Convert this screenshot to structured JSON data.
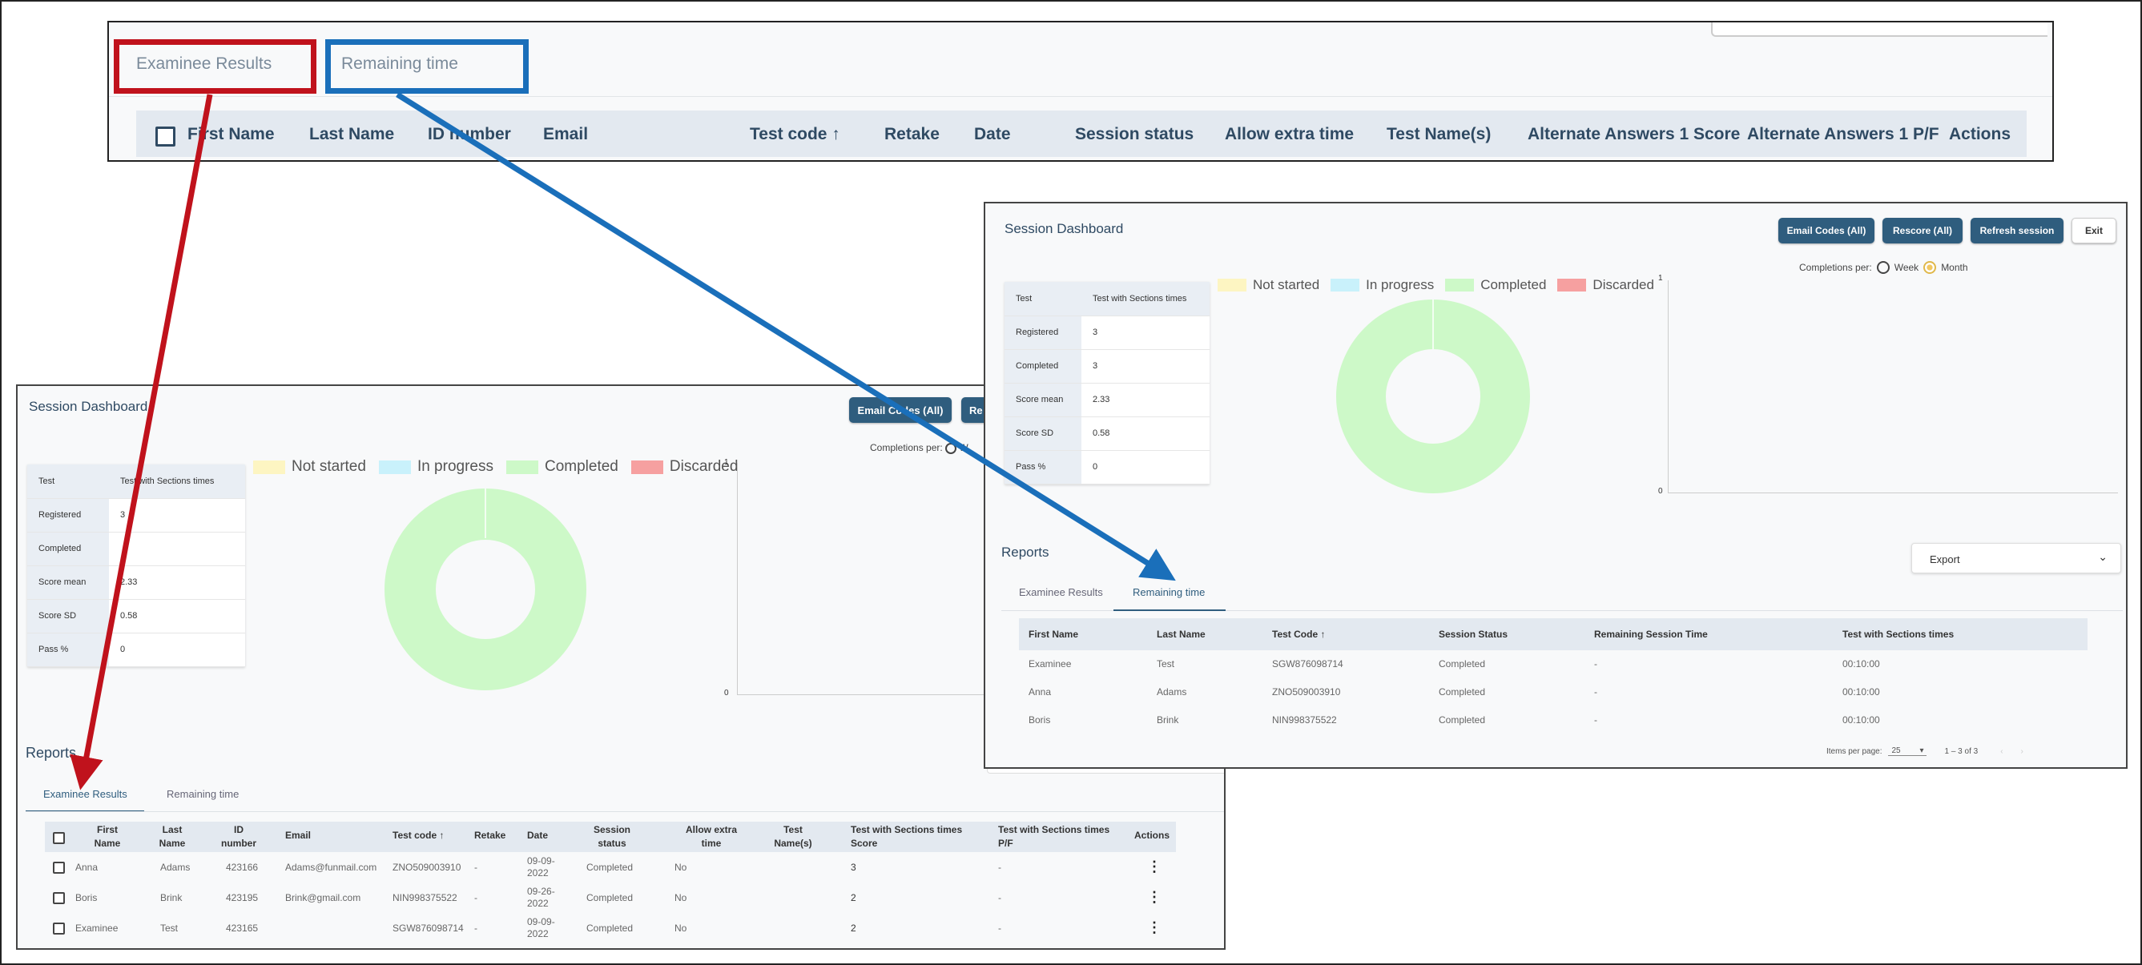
{
  "top_strip": {
    "tabs": [
      "Examinee Results",
      "Remaining time"
    ],
    "columns": [
      "First Name",
      "Last Name",
      "ID number",
      "Email",
      "Test code ↑",
      "Retake",
      "Date",
      "Session status",
      "Allow extra time",
      "Test Name(s)",
      "Alternate Answers 1 Score",
      "Alternate Answers 1 P/F",
      "Actions"
    ]
  },
  "left": {
    "title": "Session Dashboard",
    "buttons": {
      "email_codes": "Email Codes (All)",
      "rescore_partial": "Re"
    },
    "completions_label": "Completions per:",
    "week_partial": "W",
    "stats": [
      {
        "k": "Test",
        "v": "Test with Sections times"
      },
      {
        "k": "Registered",
        "v": "3"
      },
      {
        "k": "Completed",
        "v": ""
      },
      {
        "k": "Score mean",
        "v": "2.33"
      },
      {
        "k": "Score SD",
        "v": "0.58"
      },
      {
        "k": "Pass %",
        "v": "0"
      }
    ],
    "legend": [
      "Not started",
      "In progress",
      "Completed",
      "Discarded"
    ],
    "axis": {
      "y_top": "1",
      "y_bottom": "0"
    },
    "reports_title": "Reports",
    "tabs": [
      "Examinee Results",
      "Remaining time"
    ],
    "columns": [
      {
        "a": "First",
        "b": "Name"
      },
      {
        "a": "Last",
        "b": "Name"
      },
      {
        "a": "ID",
        "b": "number"
      },
      {
        "a": "Email",
        "b": ""
      },
      {
        "a": "Test code ↑",
        "b": ""
      },
      {
        "a": "Retake",
        "b": ""
      },
      {
        "a": "Date",
        "b": ""
      },
      {
        "a": "Session",
        "b": "status"
      },
      {
        "a": "Allow extra",
        "b": "time"
      },
      {
        "a": "Test",
        "b": "Name(s)"
      },
      {
        "a": "Test with Sections times",
        "b": "Score"
      },
      {
        "a": "Test with Sections times",
        "b": "P/F"
      },
      {
        "a": "Actions",
        "b": ""
      }
    ],
    "rows": [
      {
        "first": "Anna",
        "last": "Adams",
        "id": "423166",
        "email": "Adams@funmail.com",
        "code": "ZNO509003910",
        "retake": "-",
        "date1": "09-09-",
        "date2": "2022",
        "status": "Completed",
        "extra": "No",
        "score": "3",
        "pf": "-"
      },
      {
        "first": "Boris",
        "last": "Brink",
        "id": "423195",
        "email": "Brink@gmail.com",
        "code": "NIN998375522",
        "retake": "-",
        "date1": "09-26-",
        "date2": "2022",
        "status": "Completed",
        "extra": "No",
        "score": "2",
        "pf": "-"
      },
      {
        "first": "Examinee",
        "last": "Test",
        "id": "423165",
        "email": "",
        "code": "SGW876098714",
        "retake": "-",
        "date1": "09-09-",
        "date2": "2022",
        "status": "Completed",
        "extra": "No",
        "score": "2",
        "pf": "-"
      }
    ]
  },
  "right": {
    "title": "Session Dashboard",
    "buttons": {
      "email_codes": "Email Codes (All)",
      "rescore": "Rescore (All)",
      "refresh": "Refresh session",
      "exit": "Exit"
    },
    "completions_label": "Completions per:",
    "radio": {
      "week": "Week",
      "month": "Month",
      "selected": "Month"
    },
    "stats": [
      {
        "k": "Test",
        "v": "Test with Sections times"
      },
      {
        "k": "Registered",
        "v": "3"
      },
      {
        "k": "Completed",
        "v": "3"
      },
      {
        "k": "Score mean",
        "v": "2.33"
      },
      {
        "k": "Score SD",
        "v": "0.58"
      },
      {
        "k": "Pass %",
        "v": "0"
      }
    ],
    "legend": [
      "Not started",
      "In progress",
      "Completed",
      "Discarded"
    ],
    "axis": {
      "y_top": "1",
      "y_bottom": "0"
    },
    "reports_title": "Reports",
    "export_label": "Export",
    "tabs": [
      "Examinee Results",
      "Remaining time"
    ],
    "columns": [
      "First Name",
      "Last Name",
      "Test Code ↑",
      "Session Status",
      "Remaining Session Time",
      "Test with Sections times"
    ],
    "rows": [
      {
        "first": "Examinee",
        "last": "Test",
        "code": "SGW876098714",
        "status": "Completed",
        "remaining": "-",
        "sect": "00:10:00"
      },
      {
        "first": "Anna",
        "last": "Adams",
        "code": "ZNO509003910",
        "status": "Completed",
        "remaining": "-",
        "sect": "00:10:00"
      },
      {
        "first": "Boris",
        "last": "Brink",
        "code": "NIN998375522",
        "status": "Completed",
        "remaining": "-",
        "sect": "00:10:00"
      }
    ],
    "pager": {
      "items_label": "Items per page:",
      "items_value": "25",
      "range": "1 – 3 of 3"
    }
  },
  "colors": {
    "primary": "#2f5d7e",
    "highlight_red": "#c0121c",
    "highlight_blue": "#1a6fba",
    "not_started": "#fdf5c2",
    "in_progress": "#c9f1fb",
    "completed": "#cdf9c8",
    "discarded": "#f6a0a0"
  },
  "donut": {
    "completed_fraction": 1.0
  }
}
